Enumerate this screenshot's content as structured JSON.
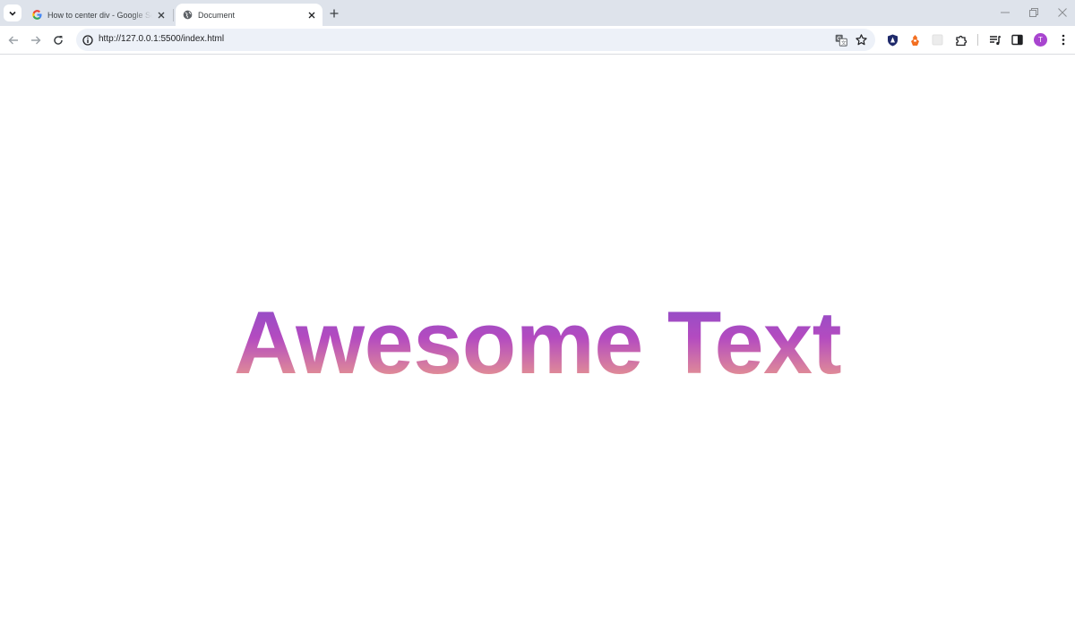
{
  "browser": {
    "tabs": [
      {
        "title": "How to center div - Google Search",
        "favicon": "google-g-icon",
        "active": false
      },
      {
        "title": "Document",
        "favicon": "globe-icon",
        "active": true
      }
    ],
    "address_bar": {
      "url": "http://127.0.0.1:5500/index.html"
    },
    "profile_initial": "T"
  },
  "page": {
    "heading": "Awesome Text",
    "gradient_colors": [
      "#8a4ec9",
      "#b44bc0",
      "#eea08a"
    ]
  }
}
